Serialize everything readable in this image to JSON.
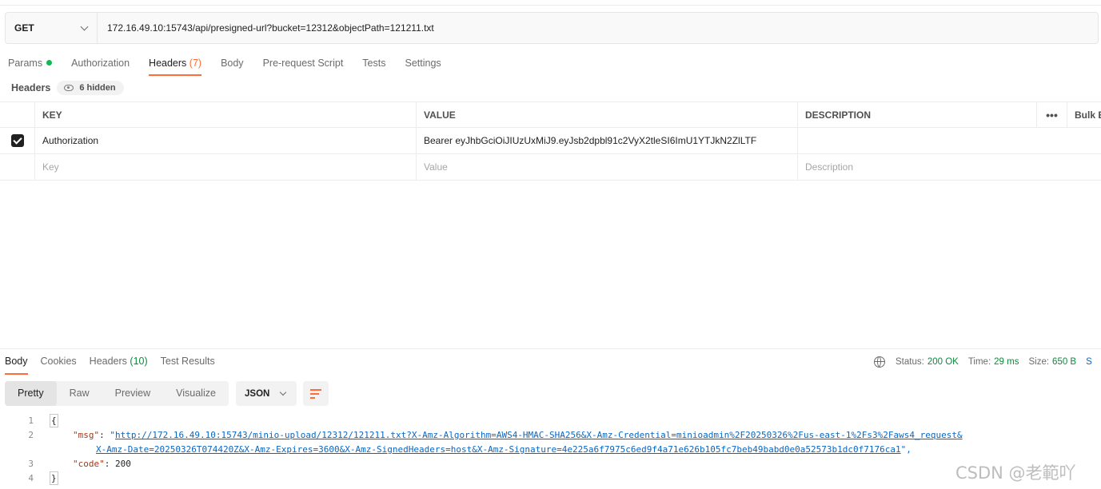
{
  "request": {
    "method": "GET",
    "url": "172.16.49.10:15743/api/presigned-url?bucket=12312&objectPath=121211.txt"
  },
  "request_tabs": [
    {
      "label": "Params",
      "count": ""
    },
    {
      "label": "Authorization",
      "count": ""
    },
    {
      "label": "Headers",
      "count": "(7)"
    },
    {
      "label": "Body",
      "count": ""
    },
    {
      "label": "Pre-request Script",
      "count": ""
    },
    {
      "label": "Tests",
      "count": ""
    },
    {
      "label": "Settings",
      "count": ""
    }
  ],
  "headers_section": {
    "label": "Headers",
    "hidden": "6 hidden"
  },
  "headers_table": {
    "columns": {
      "key": "KEY",
      "value": "VALUE",
      "description": "DESCRIPTION",
      "more": "•••",
      "bulk": "Bulk E"
    },
    "rows": [
      {
        "key": "Authorization",
        "value": "Bearer eyJhbGciOiJIUzUxMiJ9.eyJsb2dpbl91c2VyX2tleSI6ImU1YTJkN2ZlLTF",
        "description": "",
        "checked": true
      }
    ],
    "placeholder": {
      "key": "Key",
      "value": "Value",
      "description": "Description"
    }
  },
  "response_tabs": [
    {
      "label": "Body",
      "count": ""
    },
    {
      "label": "Cookies",
      "count": ""
    },
    {
      "label": "Headers",
      "count": "(10)"
    },
    {
      "label": "Test Results",
      "count": ""
    }
  ],
  "status_bar": {
    "status_label": "Status:",
    "status_value": "200 OK",
    "time_label": "Time:",
    "time_value": "29 ms",
    "size_label": "Size:",
    "size_value": "650 B",
    "cut_label": "S"
  },
  "view_modes": [
    "Pretty",
    "Raw",
    "Preview",
    "Visualize"
  ],
  "format": "JSON",
  "code": {
    "line_numbers": [
      "1",
      "2",
      "3",
      "4"
    ],
    "open_brace": "{",
    "close_brace": "}",
    "msg_key": "\"msg\"",
    "colon": ": ",
    "quote_open": "\"",
    "url_part1": "http://172.16.49.10:15743/minio-upload/12312/121211.txt?X-Amz-Algorithm=AWS4-HMAC-SHA256&X-Amz-Credential=minioadmin%2F20250326%2Fus-east-1%2Fs3%2Faws4_request&",
    "url_part2": "X-Amz-Date=20250326T074420Z&X-Amz-Expires=3600&X-Amz-SignedHeaders=host&X-Amz-Signature=4e225a6f7975c6ed9f4a71e626b105fc7beb49babd0e0a52573b1dc0f7176ca1",
    "quote_close_comma": "\",",
    "code_key": "\"code\"",
    "code_value": "200"
  },
  "watermark": "CSDN @老範吖",
  "colors": {
    "accent": "#ff6c37",
    "success": "#0cbb52",
    "link": "#0a66c2"
  }
}
